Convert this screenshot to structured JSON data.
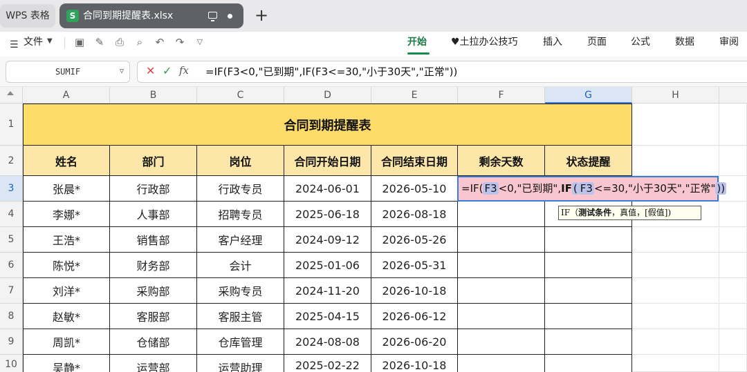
{
  "titlebar": {
    "home_tab": "WPS 表格",
    "file_tab": "合同到期提醒表.xlsx",
    "file_logo": "S"
  },
  "ribbon": {
    "file_menu": "文件",
    "tabs": [
      "开始",
      "♥土拉办公技巧",
      "插入",
      "页面",
      "公式",
      "数据",
      "审阅"
    ],
    "active_tab": "开始"
  },
  "formula_bar": {
    "name_box": "SUMIF",
    "formula": "=IF(F3<0,\"已到期\",IF(F3<=30,\"小于30天\",\"正常\"))"
  },
  "sheet": {
    "columns": [
      "A",
      "B",
      "C",
      "D",
      "E",
      "F",
      "G",
      "H"
    ],
    "rows": [
      "1",
      "2",
      "3",
      "4",
      "5",
      "6",
      "7",
      "8",
      "9",
      "10"
    ],
    "title": "合同到期提醒表",
    "headers": [
      "姓名",
      "部门",
      "岗位",
      "合同开始日期",
      "合同结束日期",
      "剩余天数",
      "状态提醒"
    ],
    "data": [
      [
        "张晨*",
        "行政部",
        "行政专员",
        "2024-06-01",
        "2026-05-10"
      ],
      [
        "李娜*",
        "人事部",
        "招聘专员",
        "2025-06-18",
        "2026-08-18"
      ],
      [
        "王浩*",
        "销售部",
        "客户经理",
        "2024-09-12",
        "2026-05-26"
      ],
      [
        "陈悦*",
        "财务部",
        "会计",
        "2025-01-06",
        "2026-05-31"
      ],
      [
        "刘洋*",
        "采购部",
        "采购专员",
        "2024-11-20",
        "2026-10-18"
      ],
      [
        "赵敏*",
        "客服部",
        "客服主管",
        "2025-04-15",
        "2026-06-12"
      ],
      [
        "周凯*",
        "仓储部",
        "仓库管理",
        "2024-08-08",
        "2026-06-20"
      ],
      [
        "吴静*",
        "运营部",
        "运营助理",
        "2025-02-22",
        "2026-10-18"
      ]
    ],
    "editing": {
      "p1": "=IF(",
      "ref1": "F3",
      "p2": "<0,\"已到期\",",
      "p3": "IF",
      "p4": "(",
      "ref2": "F3",
      "p5": "<=30,\"小于30天\",\"正常\"",
      "p6": "))"
    },
    "tooltip": {
      "func": "IF（",
      "arg1": "测试条件",
      "rest": "，真值，[假值])"
    }
  },
  "colors": {
    "title_fill": "#fddc6a",
    "header_fill": "#fde7a8",
    "editing_fill": "#f9c5cf",
    "accent": "#1a7a44"
  }
}
